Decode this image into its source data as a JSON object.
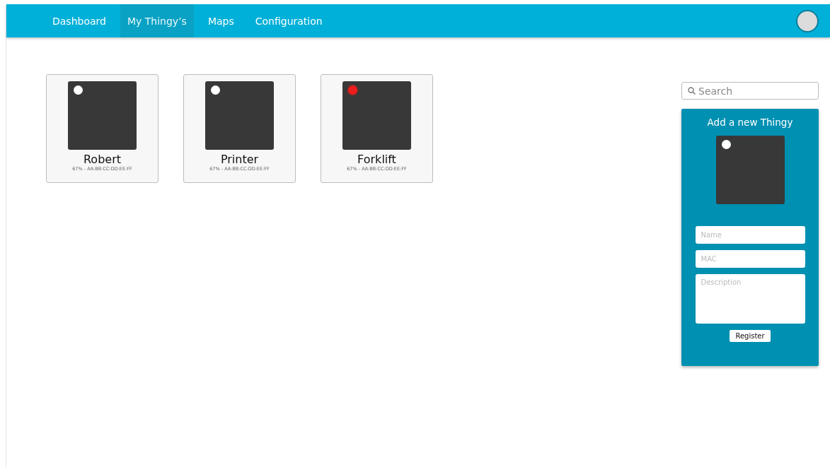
{
  "nav": {
    "tabs": [
      {
        "label": "Dashboard",
        "selected": false
      },
      {
        "label": "My Thingy’s",
        "selected": true
      },
      {
        "label": "Maps",
        "selected": false
      },
      {
        "label": "Configuration",
        "selected": false
      }
    ]
  },
  "thingies": [
    {
      "name": "Robert",
      "details": "67% - AA:BB:CC:DD:EE:FF",
      "color": "#ffffff"
    },
    {
      "name": "Printer",
      "details": "67% - AA:BB:CC:DD:EE:FF",
      "color": "#ffffff"
    },
    {
      "name": "Forklift",
      "details": "67% - AA:BB:CC:DD:EE:FF",
      "color": "#ee1c1c"
    }
  ],
  "search": {
    "placeholder": "Search"
  },
  "add_panel": {
    "title": "Add a new Thingy",
    "name_placeholder": "Name",
    "mac_placeholder": "MAC",
    "description_placeholder": "Description",
    "button": "Register"
  }
}
